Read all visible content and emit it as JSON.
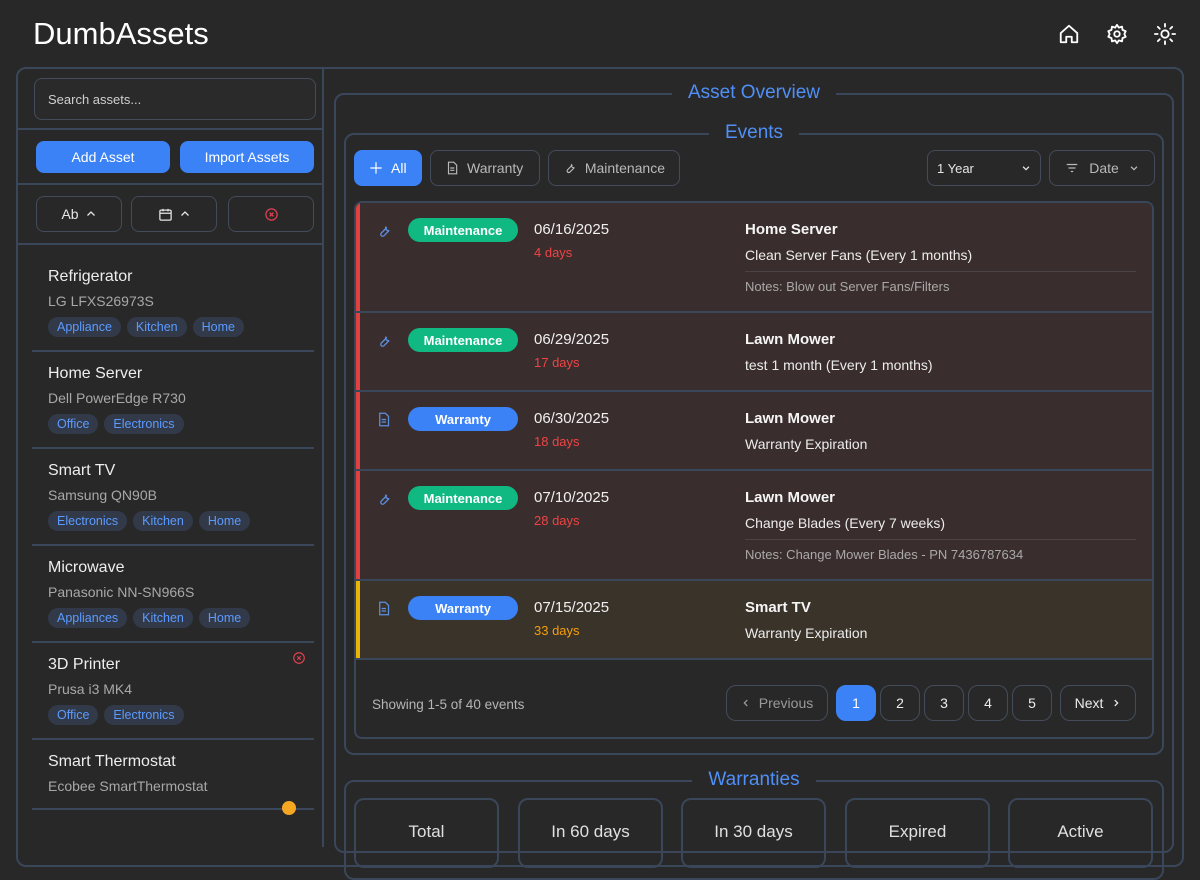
{
  "app": {
    "title": "DumbAssets"
  },
  "header": {
    "icons": [
      "home-icon",
      "gear-icon",
      "sun-icon"
    ]
  },
  "sidebar": {
    "search_placeholder": "Search assets...",
    "add_label": "Add Asset",
    "import_label": "Import Assets",
    "sort_name_label": "Ab",
    "assets": [
      {
        "name": "Refrigerator",
        "model": "LG LFXS26973S",
        "tags": [
          "Appliance",
          "Kitchen",
          "Home"
        ],
        "alert": false
      },
      {
        "name": "Home Server",
        "model": "Dell PowerEdge R730",
        "tags": [
          "Office",
          "Electronics"
        ],
        "alert": false
      },
      {
        "name": "Smart TV",
        "model": "Samsung QN90B",
        "tags": [
          "Electronics",
          "Kitchen",
          "Home"
        ],
        "alert": false
      },
      {
        "name": "Microwave",
        "model": "Panasonic NN-SN966S",
        "tags": [
          "Appliances",
          "Kitchen",
          "Home"
        ],
        "alert": false
      },
      {
        "name": "3D Printer",
        "model": "Prusa i3 MK4",
        "tags": [
          "Office",
          "Electronics"
        ],
        "alert": true
      },
      {
        "name": "Smart Thermostat",
        "model": "Ecobee SmartThermostat",
        "tags": [],
        "alert": false
      }
    ]
  },
  "overview": {
    "title": "Asset Overview",
    "events": {
      "title": "Events",
      "filters": {
        "all": "All",
        "warranty": "Warranty",
        "maintenance": "Maintenance"
      },
      "range_value": "1 Year",
      "sort_label": "Date",
      "items": [
        {
          "type": "Maintenance",
          "date": "06/16/2025",
          "days": "4 days",
          "asset": "Home Server",
          "title": "Clean Server Fans (Every 1 months)",
          "notes": "Notes: Blow out Server Fans/Filters",
          "level": "danger"
        },
        {
          "type": "Maintenance",
          "date": "06/29/2025",
          "days": "17 days",
          "asset": "Lawn Mower",
          "title": "test 1 month (Every 1 months)",
          "notes": "",
          "level": "danger"
        },
        {
          "type": "Warranty",
          "date": "06/30/2025",
          "days": "18 days",
          "asset": "Lawn Mower",
          "title": "Warranty Expiration",
          "notes": "",
          "level": "danger"
        },
        {
          "type": "Maintenance",
          "date": "07/10/2025",
          "days": "28 days",
          "asset": "Lawn Mower",
          "title": "Change Blades (Every 7 weeks)",
          "notes": "Notes: Change Mower Blades - PN 7436787634",
          "level": "danger"
        },
        {
          "type": "Warranty",
          "date": "07/15/2025",
          "days": "33 days",
          "asset": "Smart TV",
          "title": "Warranty Expiration",
          "notes": "",
          "level": "warning"
        }
      ],
      "pagination": {
        "info": "Showing 1-5 of 40 events",
        "previous": "Previous",
        "next": "Next",
        "pages": [
          "1",
          "2",
          "3",
          "4",
          "5"
        ],
        "current": "1"
      }
    },
    "warranties": {
      "title": "Warranties",
      "stats": [
        "Total",
        "In 60 days",
        "In 30 days",
        "Expired",
        "Active"
      ]
    }
  },
  "colors": {
    "accent": "#3b82f6",
    "maintenance": "#10b981",
    "danger": "#ef4444",
    "warning": "#f59e0b"
  }
}
